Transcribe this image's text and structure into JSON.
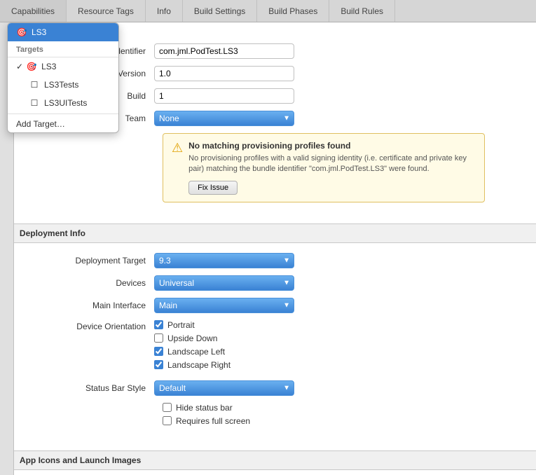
{
  "tabs": [
    {
      "id": "capabilities",
      "label": "Capabilities",
      "active": false
    },
    {
      "id": "resource-tags",
      "label": "Resource Tags",
      "active": false
    },
    {
      "id": "info",
      "label": "Info",
      "active": false
    },
    {
      "id": "build-settings",
      "label": "Build Settings",
      "active": false
    },
    {
      "id": "build-phases",
      "label": "Build Phases",
      "active": false
    },
    {
      "id": "build-rules",
      "label": "Build Rules",
      "active": false
    }
  ],
  "dropdown": {
    "section_label": "Targets",
    "items": [
      {
        "id": "ls3",
        "label": "LS3",
        "icon": "🎯",
        "selected": true,
        "checked": true
      },
      {
        "id": "ls3tests",
        "label": "LS3Tests",
        "icon": "☐",
        "selected": false,
        "checked": false
      },
      {
        "id": "ls3uitests",
        "label": "LS3UITests",
        "icon": "☐",
        "selected": false,
        "checked": false
      }
    ],
    "add_target_label": "Add Target…"
  },
  "form": {
    "bundle_identifier_label": "Bundle Identifier",
    "bundle_identifier_value": "com.jml.PodTest.LS3",
    "version_label": "Version",
    "version_value": "1.0",
    "build_label": "Build",
    "build_value": "1",
    "team_label": "Team",
    "team_value": "None"
  },
  "warning": {
    "icon": "⚠",
    "title": "No matching provisioning profiles found",
    "text": "No provisioning profiles with a valid signing identity (i.e. certificate and private key pair) matching the bundle identifier \"com.jml.PodTest.LS3\" were found.",
    "fix_button_label": "Fix Issue"
  },
  "deployment_info": {
    "section_title": "Deployment Info",
    "deployment_target_label": "Deployment Target",
    "deployment_target_value": "9.3",
    "devices_label": "Devices",
    "devices_value": "Universal",
    "main_interface_label": "Main Interface",
    "main_interface_value": "Main",
    "device_orientation_label": "Device Orientation",
    "portrait_label": "Portrait",
    "portrait_checked": true,
    "upside_down_label": "Upside Down",
    "upside_down_checked": false,
    "landscape_left_label": "Landscape Left",
    "landscape_left_checked": true,
    "landscape_right_label": "Landscape Right",
    "landscape_right_checked": true,
    "status_bar_style_label": "Status Bar Style",
    "status_bar_style_value": "Default",
    "hide_status_bar_label": "Hide status bar",
    "hide_status_bar_checked": false,
    "requires_full_screen_label": "Requires full screen",
    "requires_full_screen_checked": false
  },
  "app_icons_section": {
    "section_title": "App Icons and Launch Images"
  }
}
